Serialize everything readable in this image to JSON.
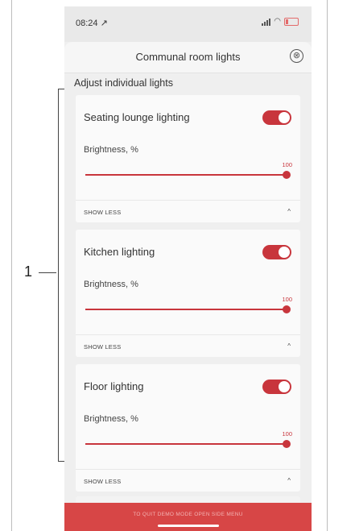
{
  "annotation": {
    "label": "1"
  },
  "status": {
    "time": "08:24 ↗"
  },
  "header": {
    "title": "Communal room lights",
    "close_glyph": "⊗"
  },
  "section": {
    "title": "Adjust individual lights"
  },
  "lights": [
    {
      "name": "Seating lounge lighting",
      "on": true,
      "brightness_label": "Brightness, %",
      "brightness": 100,
      "brightness_text": "100",
      "collapse_label": "SHOW LESS",
      "chevron": "^"
    },
    {
      "name": "Kitchen lighting",
      "on": true,
      "brightness_label": "Brightness, %",
      "brightness": 100,
      "brightness_text": "100",
      "collapse_label": "SHOW LESS",
      "chevron": "^"
    },
    {
      "name": "Floor lighting",
      "on": true,
      "brightness_label": "Brightness, %",
      "brightness": 100,
      "brightness_text": "100",
      "collapse_label": "SHOW LESS",
      "chevron": "^"
    }
  ],
  "footer": {
    "demo_text": "TO QUIT DEMO MODE OPEN SIDE MENU"
  },
  "colors": {
    "accent": "#c8353c",
    "demo_bar": "#d74646",
    "background": "#efefef"
  },
  "icons": {
    "close": "close-circle-icon",
    "chevron": "chevron-up-icon",
    "wifi": "wifi-icon",
    "battery": "battery-icon",
    "signal": "signal-icon"
  }
}
